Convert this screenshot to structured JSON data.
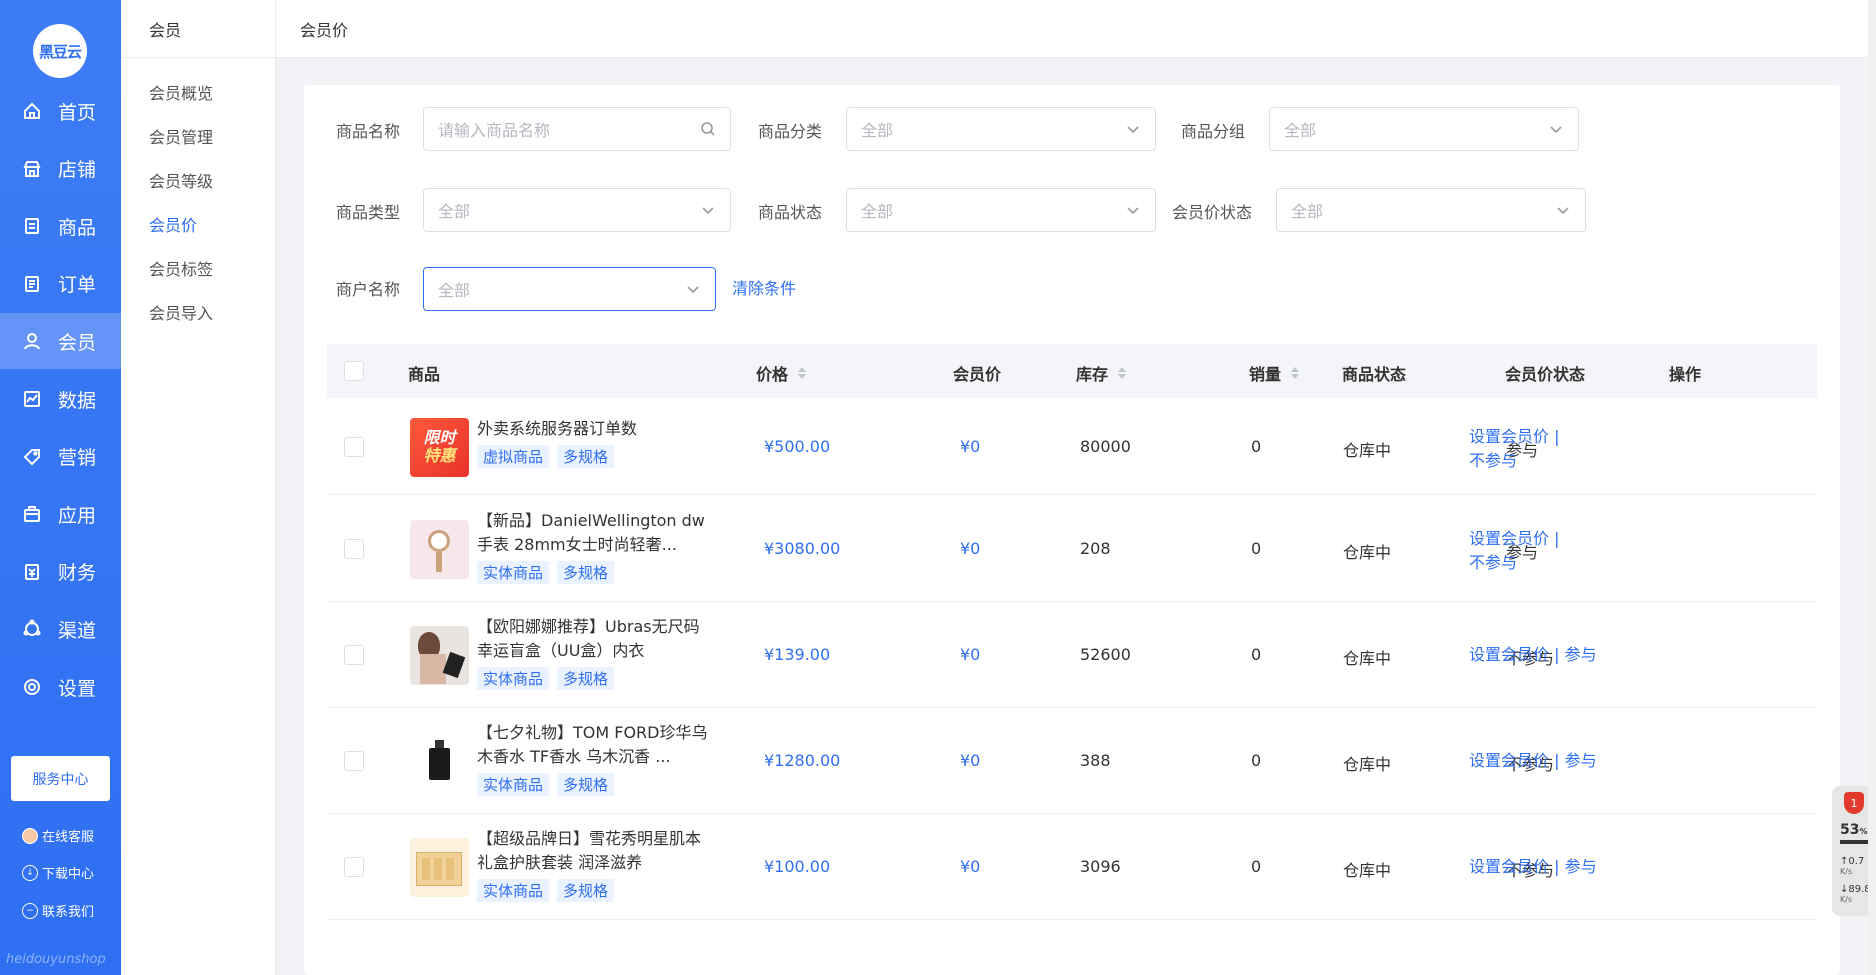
{
  "sidebar": {
    "logo_text": "黑豆云",
    "items": [
      {
        "label": "首页",
        "icon": "home-icon"
      },
      {
        "label": "店铺",
        "icon": "store-icon"
      },
      {
        "label": "商品",
        "icon": "product-icon"
      },
      {
        "label": "订单",
        "icon": "order-icon"
      },
      {
        "label": "会员",
        "icon": "member-icon"
      },
      {
        "label": "数据",
        "icon": "data-icon"
      },
      {
        "label": "营销",
        "icon": "tag-icon"
      },
      {
        "label": "应用",
        "icon": "app-icon"
      },
      {
        "label": "财务",
        "icon": "finance-icon"
      },
      {
        "label": "渠道",
        "icon": "channel-icon"
      },
      {
        "label": "设置",
        "icon": "gear-icon"
      }
    ],
    "active_index": 4,
    "service_button": "服务中心",
    "online_service": "在线客服",
    "download_center": "下载中心",
    "contact_us": "联系我们",
    "brand_footer": "heidouyunshop"
  },
  "submenu": {
    "title": "会员",
    "items": [
      "会员概览",
      "会员管理",
      "会员等级",
      "会员价",
      "会员标签",
      "会员导入"
    ],
    "active_index": 3
  },
  "header": {
    "title": "会员价"
  },
  "filters": {
    "product_name": {
      "label": "商品名称",
      "placeholder": "请输入商品名称"
    },
    "category": {
      "label": "商品分类",
      "value": "全部"
    },
    "group": {
      "label": "商品分组",
      "value": "全部"
    },
    "type": {
      "label": "商品类型",
      "value": "全部"
    },
    "status": {
      "label": "商品状态",
      "value": "全部"
    },
    "member_price_status": {
      "label": "会员价状态",
      "value": "全部"
    },
    "merchant": {
      "label": "商户名称",
      "value": "全部"
    },
    "clear": "清除条件"
  },
  "table": {
    "headers": {
      "product": "商品",
      "price": "价格",
      "member_price": "会员价",
      "stock": "库存",
      "sales": "销量",
      "product_status": "商品状态",
      "member_price_status": "会员价状态",
      "actions": "操作"
    },
    "rows": [
      {
        "name": "外卖系统服务器订单数",
        "tag1": "虚拟商品",
        "tag2": "多规格",
        "price": "¥500.00",
        "member_price": "¥0",
        "stock": "80000",
        "sales": "0",
        "status": "仓库中",
        "mp_status": "参与",
        "op1": "设置会员价 |",
        "op2": "不参与",
        "thumb": "promo"
      },
      {
        "name": "【新品】DanielWellington dw手表 28mm女士时尚轻奢...",
        "tag1": "实体商品",
        "tag2": "多规格",
        "price": "¥3080.00",
        "member_price": "¥0",
        "stock": "208",
        "sales": "0",
        "status": "仓库中",
        "mp_status": "参与",
        "op1": "设置会员价 |",
        "op2": "不参与",
        "thumb": "watch"
      },
      {
        "name": "【欧阳娜娜推荐】Ubras无尺码幸运盲盒（UU盒）内衣",
        "tag1": "实体商品",
        "tag2": "多规格",
        "price": "¥139.00",
        "member_price": "¥0",
        "stock": "52600",
        "sales": "0",
        "status": "仓库中",
        "mp_status": "不参与",
        "op1": "设置会员价 | 参与",
        "op2": "",
        "thumb": "model"
      },
      {
        "name": "【七夕礼物】TOM FORD珍华乌木香水 TF香水 乌木沉香 ...",
        "tag1": "实体商品",
        "tag2": "多规格",
        "price": "¥1280.00",
        "member_price": "¥0",
        "stock": "388",
        "sales": "0",
        "status": "仓库中",
        "mp_status": "不参与",
        "op1": "设置会员价 | 参与",
        "op2": "",
        "thumb": "perfume"
      },
      {
        "name": "【超级品牌日】雪花秀明星肌本礼盒护肤套装 润泽滋养",
        "tag1": "实体商品",
        "tag2": "多规格",
        "price": "¥100.00",
        "member_price": "¥0",
        "stock": "3096",
        "sales": "0",
        "status": "仓库中",
        "mp_status": "不参与",
        "op1": "设置会员价 | 参与",
        "op2": "",
        "thumb": "skincare"
      }
    ]
  },
  "promo_badge": {
    "line1": "限时",
    "line2": "特惠"
  },
  "widget": {
    "alert_count": "1",
    "percent": "53",
    "percent_unit": "%",
    "upload": "0.7",
    "download": "89.8",
    "unit": "K/s"
  },
  "colors": {
    "primary": "#2f6ff2",
    "sidebar": "#3d7cf5"
  }
}
